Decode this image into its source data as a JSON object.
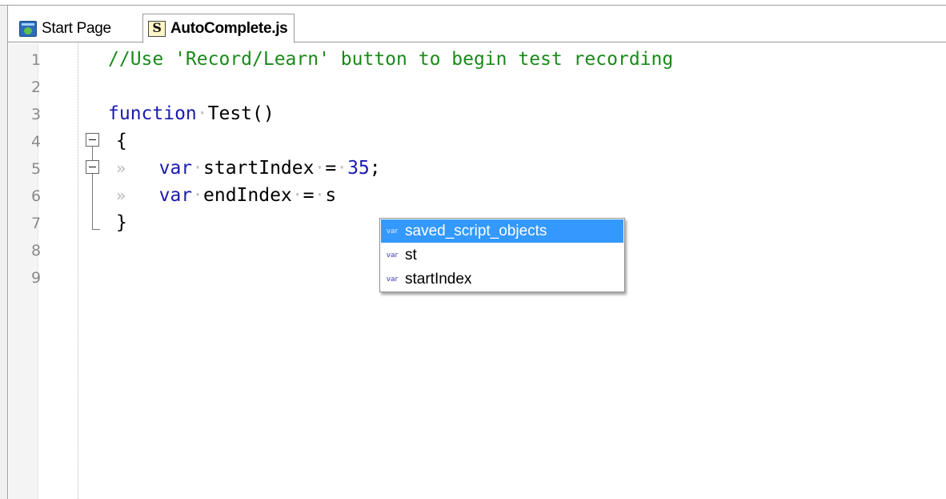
{
  "tabs": [
    {
      "label": "Start Page",
      "icon": "start-page-icon",
      "active": false
    },
    {
      "label": "AutoComplete.js",
      "icon": "script-file-icon",
      "icon_glyph": "S",
      "active": true
    }
  ],
  "editor": {
    "line_numbers": [
      "1",
      "2",
      "3",
      "4",
      "5",
      "6",
      "7",
      "8",
      "9"
    ],
    "lines": {
      "l1": {
        "comment": "//Use 'Record/Learn' button to begin test recording"
      },
      "l3": {
        "keyword": "function",
        "name": "Test()"
      },
      "l4": {
        "brace": "{"
      },
      "l5": {
        "keyword": "var",
        "ident": "startIndex",
        "op": "=",
        "num": "35",
        "end": ";"
      },
      "l6": {
        "keyword": "var",
        "ident": "endIndex",
        "op": "=",
        "typed": "s"
      },
      "l7": {
        "brace": "}"
      }
    },
    "whitespace_marker": "»"
  },
  "autocomplete": {
    "type_tag": "var",
    "items": [
      {
        "label": "saved_script_objects",
        "selected": true
      },
      {
        "label": "st",
        "selected": false
      },
      {
        "label": "startIndex",
        "selected": false
      }
    ]
  },
  "colors": {
    "comment": "#1a8a1a",
    "keyword": "#1a1ab0",
    "selection": "#3399ff"
  }
}
